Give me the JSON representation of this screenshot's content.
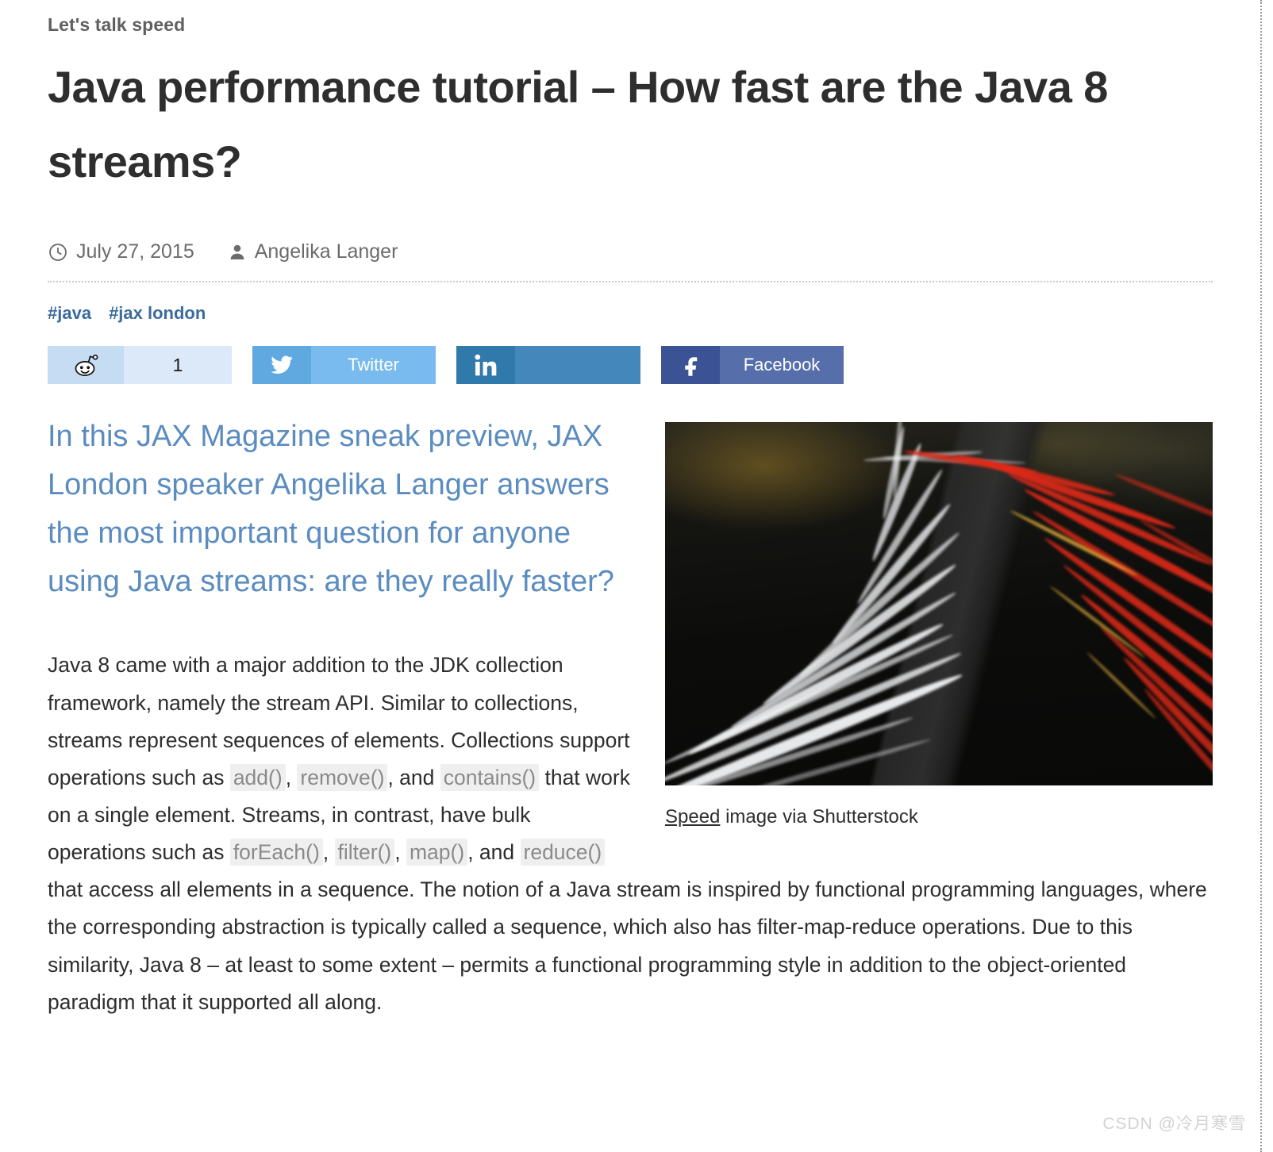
{
  "article": {
    "kicker": "Let's talk speed",
    "headline": "Java performance tutorial – How fast are the Java 8 streams?",
    "date": "July 27, 2015",
    "author": "Angelika Langer",
    "tags": [
      "#java",
      "#jax london"
    ],
    "lede": "In this JAX Magazine sneak preview, JAX London speaker Angelika Langer answers the most important question for anyone using Java streams: are they really faster?",
    "body_parts": [
      {
        "type": "text",
        "value": "Java 8 came with a major addition to the JDK collection framework, namely the stream API. Similar to collections, streams represent sequences of elements. Collections support operations such as "
      },
      {
        "type": "code",
        "value": "add()"
      },
      {
        "type": "text",
        "value": ", "
      },
      {
        "type": "code",
        "value": "remove()"
      },
      {
        "type": "text",
        "value": ", and "
      },
      {
        "type": "code",
        "value": "contains()"
      },
      {
        "type": "text",
        "value": " that work on a single element. Streams, in contrast, have bulk operations such as "
      },
      {
        "type": "code",
        "value": "forEach()"
      },
      {
        "type": "text",
        "value": ", "
      },
      {
        "type": "code",
        "value": "filter()"
      },
      {
        "type": "text",
        "value": ", "
      },
      {
        "type": "code",
        "value": "map()"
      },
      {
        "type": "text",
        "value": ", and "
      },
      {
        "type": "code",
        "value": "reduce()"
      },
      {
        "type": "text",
        "value": " that access all elements in a sequence. The notion of a Java stream is inspired by functional programming languages, where the corresponding abstraction is typically called a sequence, which also has filter-map-reduce operations. Due to this similarity, Java 8 – at least to some extent – permits a functional programming style in addition to the object-oriented paradigm that it supported all along."
      }
    ]
  },
  "figure": {
    "caption_link": "Speed",
    "caption_rest": " image via Shutterstock",
    "alt": "long exposure night highway light trails"
  },
  "share": {
    "buttons": [
      {
        "id": "reddit",
        "icon": "reddit-icon",
        "label": "1",
        "glyph_color": "#c6dcf2",
        "label_color": "#dbe9f8"
      },
      {
        "id": "twitter",
        "icon": "twitter-icon",
        "label": "Twitter",
        "glyph_color": "#5fa8e0",
        "label_color": "#79bbef"
      },
      {
        "id": "linkedin",
        "icon": "linkedin-icon",
        "label": "",
        "glyph_color": "#3079ab",
        "label_color": "#4487ba"
      },
      {
        "id": "facebook",
        "icon": "facebook-icon",
        "label": "Facebook",
        "glyph_color": "#3b5395",
        "label_color": "#566fab"
      }
    ]
  },
  "icons": {
    "clock": "clock-icon",
    "user": "user-icon"
  },
  "watermark": "CSDN @冷月寒雪"
}
